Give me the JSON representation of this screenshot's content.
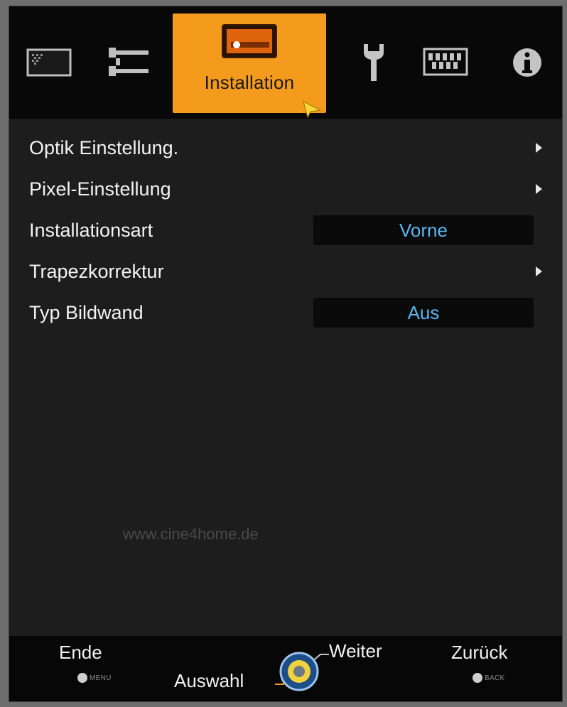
{
  "tabs": [
    {
      "icon": "picture-icon"
    },
    {
      "icon": "signal-icon"
    },
    {
      "icon": "installation-icon",
      "label": "Installation",
      "active": true
    },
    {
      "icon": "wrench-icon"
    },
    {
      "icon": "display-icon"
    },
    {
      "icon": "info-icon"
    }
  ],
  "menu": {
    "items": [
      {
        "label": "Optik Einstellung.",
        "type": "submenu"
      },
      {
        "label": "Pixel-Einstellung",
        "type": "submenu"
      },
      {
        "label": "Installationsart",
        "type": "value",
        "value": "Vorne"
      },
      {
        "label": "Trapezkorrektur",
        "type": "submenu"
      },
      {
        "label": "Typ Bildwand",
        "type": "value",
        "value": "Aus"
      }
    ]
  },
  "watermark": "www.cine4home.de",
  "footer": {
    "ende": "Ende",
    "menu_key": "MENU",
    "auswahl": "Auswahl",
    "weiter": "Weiter",
    "zurueck": "Zurück",
    "back_key": "BACK"
  },
  "colors": {
    "accent": "#f49a1c",
    "value_text": "#5cb4f0",
    "background": "#1d1d1d"
  }
}
